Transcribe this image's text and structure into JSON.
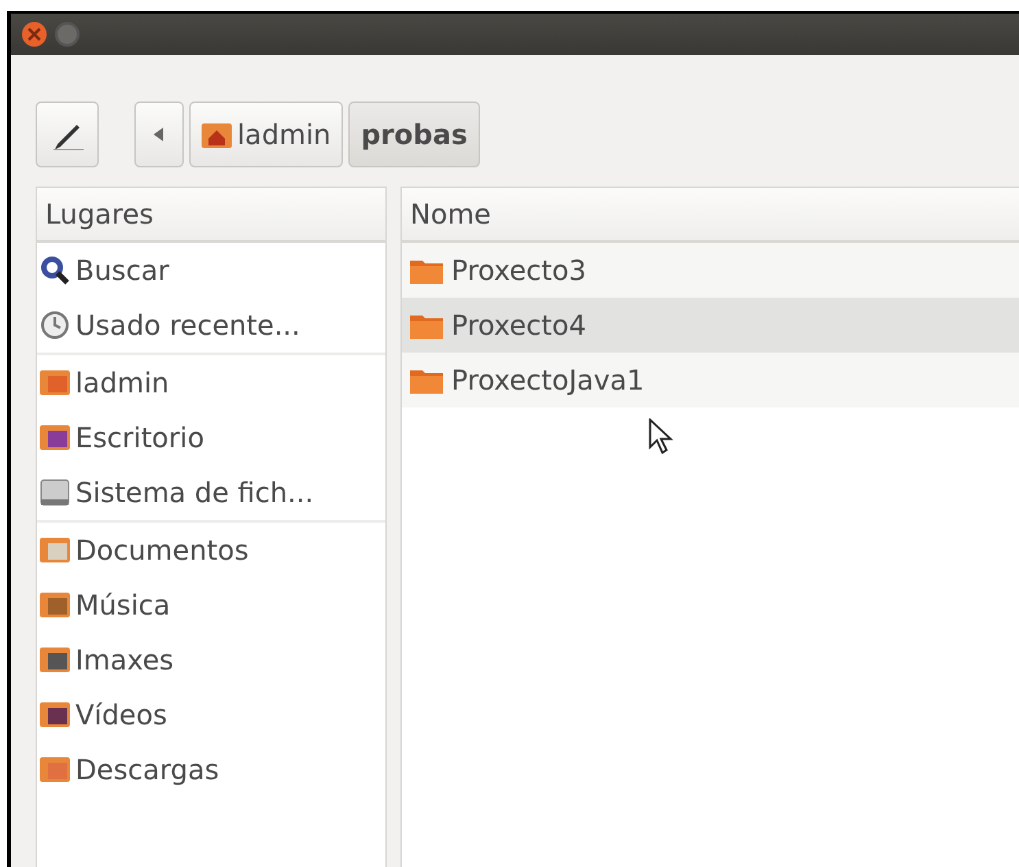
{
  "window": {
    "buttons": [
      {
        "kind": "close"
      },
      {
        "kind": "minimize"
      }
    ]
  },
  "path_bar": {
    "crumbs": [
      {
        "label": "ladmin",
        "kind": "home",
        "selected": false
      },
      {
        "label": "probas",
        "kind": "folder",
        "selected": true
      }
    ]
  },
  "sidebar": {
    "header": "Lugares",
    "groups": [
      [
        {
          "label": "Buscar",
          "kind": "search"
        },
        {
          "label": "Usado recente...",
          "kind": "recent"
        }
      ],
      [
        {
          "label": "ladmin",
          "kind": "home"
        },
        {
          "label": "Escritorio",
          "kind": "desktop"
        },
        {
          "label": "Sistema de fich...",
          "kind": "drive"
        }
      ],
      [
        {
          "label": "Documentos",
          "kind": "documents"
        },
        {
          "label": "Música",
          "kind": "music"
        },
        {
          "label": "Imaxes",
          "kind": "pictures"
        },
        {
          "label": "Vídeos",
          "kind": "videos"
        },
        {
          "label": "Descargas",
          "kind": "downloads"
        }
      ]
    ]
  },
  "file_list": {
    "column": "Nome",
    "rows": [
      {
        "name": "Proxecto3",
        "selected": false
      },
      {
        "name": "Proxecto4",
        "selected": true
      },
      {
        "name": "ProxectoJava1",
        "selected": false
      }
    ]
  }
}
